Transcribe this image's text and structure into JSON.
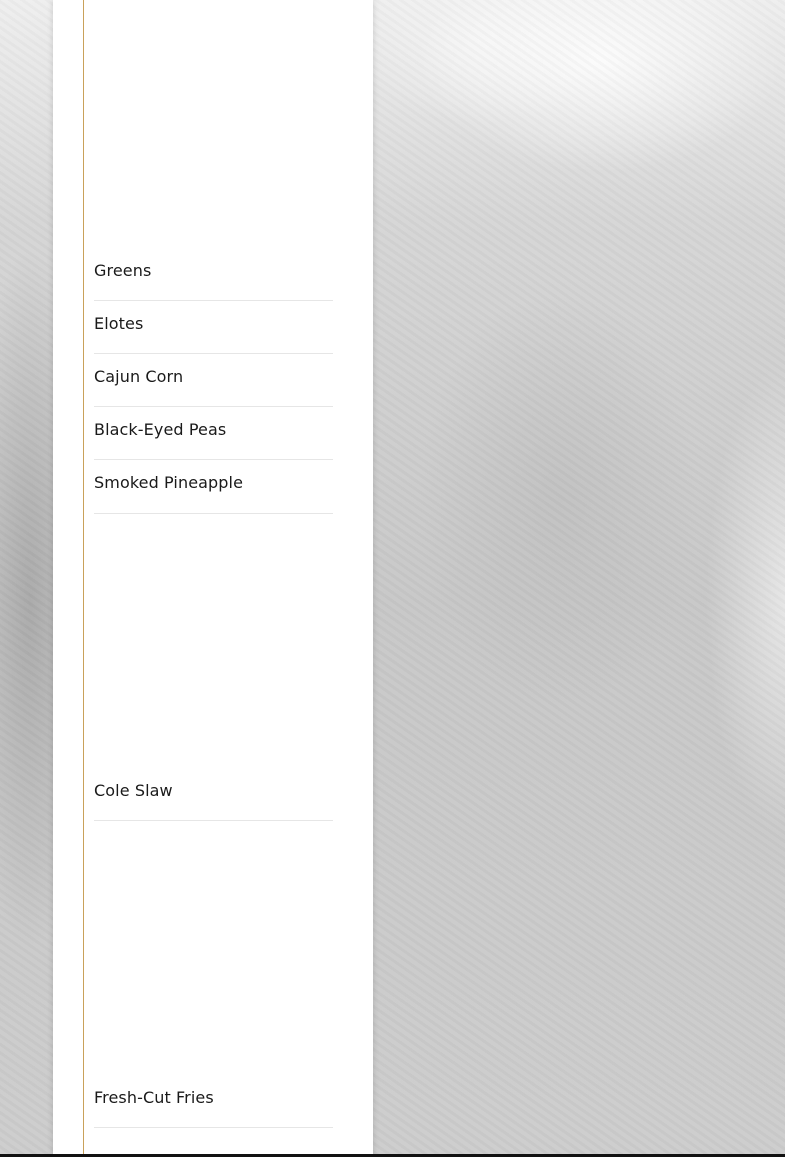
{
  "menu": {
    "items": [
      {
        "label": "Greens"
      },
      {
        "label": "Elotes"
      },
      {
        "label": "Cajun Corn"
      },
      {
        "label": "Black-Eyed Peas"
      },
      {
        "label": "Smoked Pineapple"
      },
      {
        "label": "Cole Slaw"
      },
      {
        "label": "Fresh-Cut Fries"
      }
    ]
  },
  "colors": {
    "accent": "#c9a15a",
    "text": "#1a1a1a",
    "divider": "#e6e6e6",
    "card": "#ffffff"
  }
}
